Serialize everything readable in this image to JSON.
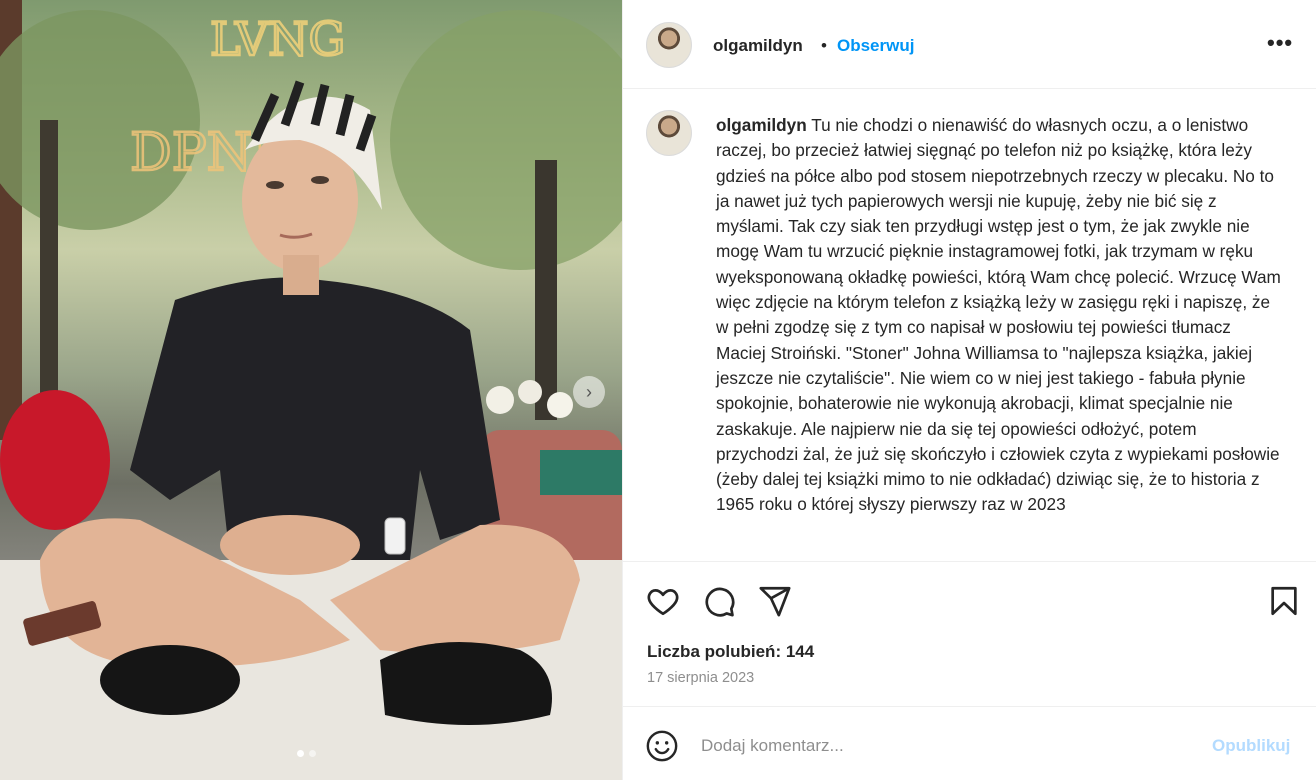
{
  "post": {
    "username": "olgamildyn",
    "separator": "•",
    "follow_label": "Obserwuj",
    "more_label": "•••"
  },
  "caption": {
    "username": "olgamildyn",
    "text": "Tu nie chodzi o nienawiść do własnych oczu, a o lenistwo raczej, bo przecież łatwiej sięgnąć po telefon niż po książkę, która leży gdzieś na półce albo pod stosem niepotrzebnych rzeczy w plecaku. No to ja nawet już tych papierowych wersji nie kupuję, żeby nie bić się z myślami. Tak czy siak ten przydługi wstęp jest o tym, że jak zwykle nie mogę Wam tu wrzucić pięknie instagramowej fotki, jak trzymam w ręku wyeksponowaną okładkę powieści, którą Wam chcę polecić. Wrzucę Wam więc zdjęcie na którym telefon z książką leży w zasięgu ręki i napiszę, że w pełni zgodzę się z tym co napisał w posłowiu tej powieści tłumacz Maciej Stroiński. \"Stoner\" Johna Williamsa to \"najlepsza książka, jakiej jeszcze nie czytaliście\". Nie wiem co w niej jest takiego - fabuła płynie spokojnie, bohaterowie nie wykonują akrobacji, klimat specjalnie nie zaskakuje. Ale najpierw nie da się tej opowieści odłożyć, potem przychodzi żal, że już się skończyło i człowiek czyta z wypiekami posłowie (żeby dalej tej książki mimo to nie odkładać) dziwiąc się, że to historia z 1965 roku o której słyszy pierwszy raz w 2023"
  },
  "stats": {
    "likes": "Liczba polubień: 144",
    "date": "17 sierpnia 2023"
  },
  "comment": {
    "placeholder": "Dodaj komentarz...",
    "publish_label": "Opublikuj"
  },
  "carousel": {
    "next_label": "›",
    "slides": 2,
    "active_slide": 1
  },
  "colors": {
    "accent": "#0095f6",
    "publish_disabled": "#b3dbff",
    "muted": "#8e8e8e",
    "text": "#262626"
  },
  "icons": [
    "heart-icon",
    "comment-icon",
    "share-icon",
    "bookmark-icon",
    "emoji-icon",
    "more-icon",
    "chevron-right-icon"
  ]
}
